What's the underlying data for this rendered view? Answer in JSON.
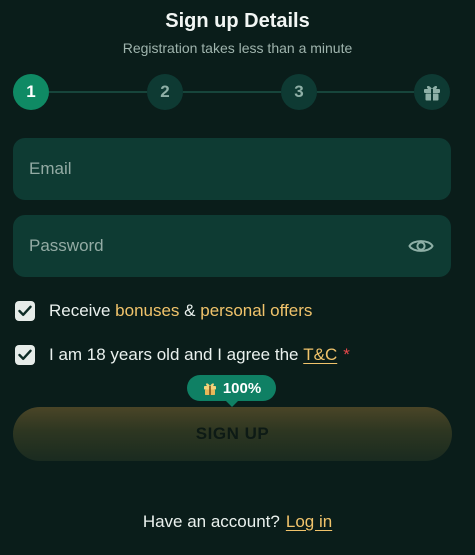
{
  "header": {
    "title": "Sign up Details",
    "subtitle": "Registration takes less than a minute"
  },
  "stepper": {
    "steps": [
      "1",
      "2",
      "3"
    ],
    "final_icon": "gift-icon",
    "active_step": 1
  },
  "form": {
    "email_placeholder": "Email",
    "password_placeholder": "Password",
    "password_toggle_icon": "eye-icon"
  },
  "checks": {
    "bonuses": {
      "checked": true,
      "prefix": "Receive",
      "bonuses_link": "bonuses",
      "amp": "&",
      "offers_link": "personal offers"
    },
    "age": {
      "checked": true,
      "text": "I am 18 years old and I agree the",
      "tc_link": "T&C",
      "required_mark": "*"
    }
  },
  "badge": {
    "icon": "gift-icon",
    "value": "100%"
  },
  "button": {
    "label": "SIGN UP"
  },
  "footer": {
    "text": "Have an account?",
    "login_link": "Log in"
  },
  "colors": {
    "background": "#0a1d1a",
    "input_bg": "#0e3b33",
    "accent": "#0f8a64",
    "highlight": "#f0c36b",
    "required": "#e8494b"
  }
}
